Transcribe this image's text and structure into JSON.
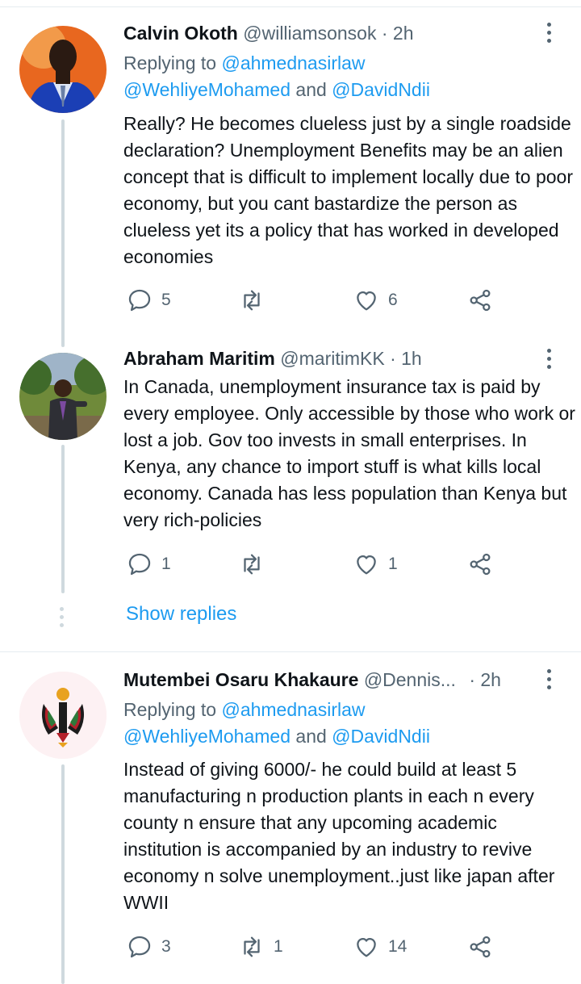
{
  "tweets": [
    {
      "name": "Calvin Okoth",
      "handle": "@williamsonsok",
      "time": "· 2h",
      "replying_prefix": "Replying to ",
      "replying_link1": "@ahmednasirlaw",
      "replying_link2": "@WehliyeMohamed",
      "replying_and": " and ",
      "replying_link3": "@DavidNdii",
      "text": "Really? He becomes clueless just by a single roadside declaration? Unemployment Benefits may be an alien concept that is difficult to implement locally due to poor economy, but you cant bastardize the person as clueless yet its a policy that has worked in developed economies",
      "replies": "5",
      "retweets": "",
      "likes": "6"
    },
    {
      "name": "Abraham Maritim",
      "handle": "@maritimKK",
      "time": "· 1h",
      "text": "In Canada, unemployment insurance tax is paid by every employee. Only accessible by those who work or lost a job. Gov too invests in small enterprises. In Kenya, any chance to import stuff is what kills local economy. Canada has less population than Kenya but very rich-policies",
      "replies": "1",
      "retweets": "",
      "likes": "1"
    },
    {
      "name": "Mutembei Osaru Khakaure",
      "handle": "@Dennis...",
      "time": "· 2h",
      "replying_prefix": "Replying to ",
      "replying_link1": "@ahmednasirlaw",
      "replying_link2": "@WehliyeMohamed",
      "replying_and": " and ",
      "replying_link3": "@DavidNdii",
      "text": "Instead of giving 6000/- he could build at least 5 manufacturing n production plants in each n every county n ensure that any upcoming academic institution is accompanied by an industry to revive economy n solve unemployment..just like japan after WWII",
      "replies": "3",
      "retweets": "1",
      "likes": "14"
    }
  ],
  "show_replies": "Show replies",
  "icons": [
    "reply-icon",
    "retweet-icon",
    "like-icon",
    "share-icon",
    "more-icon"
  ],
  "colors": {
    "link": "#1d9bf0",
    "secondary": "#536471",
    "text": "#0f1419",
    "line": "#cfd9de"
  }
}
